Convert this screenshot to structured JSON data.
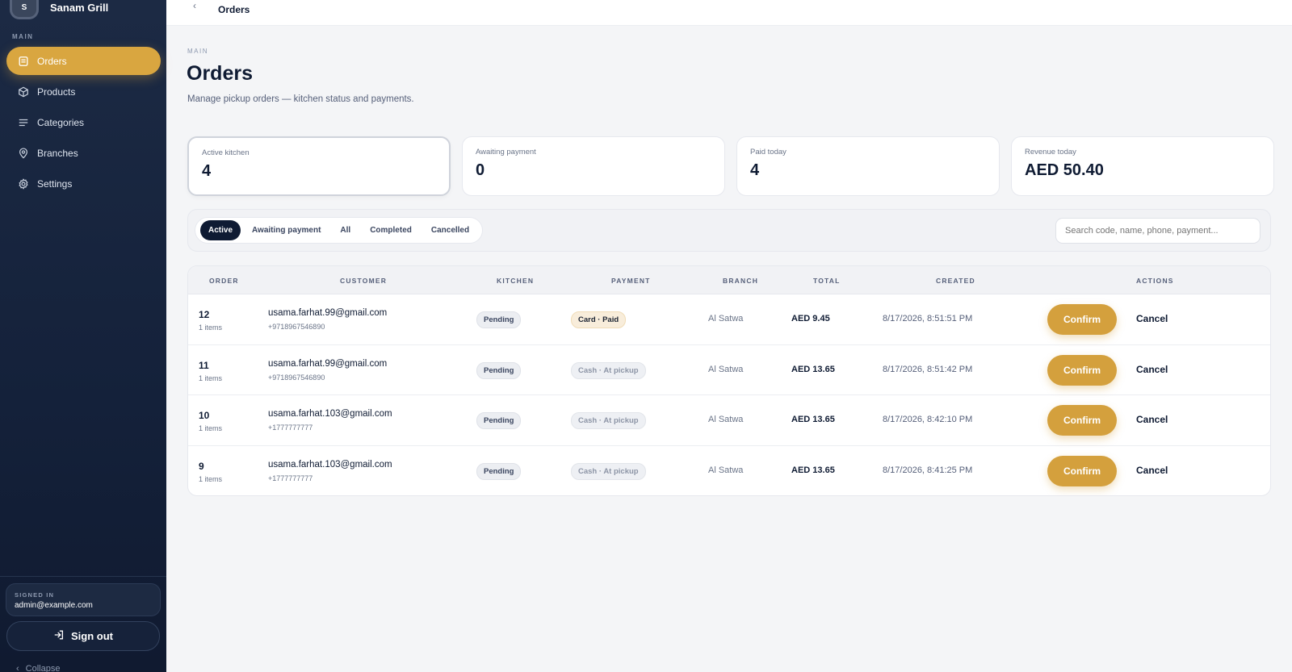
{
  "brand": {
    "initial": "S",
    "name": "Sanam Grill"
  },
  "sidebar": {
    "section_label": "MAIN",
    "items": [
      {
        "label": "Orders",
        "icon": "receipt-icon",
        "active": true
      },
      {
        "label": "Products",
        "icon": "box-icon",
        "active": false
      },
      {
        "label": "Categories",
        "icon": "list-icon",
        "active": false
      },
      {
        "label": "Branches",
        "icon": "map-pin-icon",
        "active": false
      },
      {
        "label": "Settings",
        "icon": "gear-icon",
        "active": false
      }
    ],
    "signed_in_label": "SIGNED IN",
    "signed_in_email": "admin@example.com",
    "sign_out_label": "Sign out",
    "collapse_label": "Collapse"
  },
  "topbar": {
    "back_icon": "chevron-left-icon",
    "title": "Orders"
  },
  "header": {
    "eyebrow": "MAIN",
    "title": "Orders",
    "subtitle": "Manage pickup orders — kitchen status and payments."
  },
  "stats": [
    {
      "label": "Active kitchen",
      "value": "4"
    },
    {
      "label": "Awaiting payment",
      "value": "0"
    },
    {
      "label": "Paid today",
      "value": "4"
    },
    {
      "label": "Revenue today",
      "value": "AED 50.40"
    }
  ],
  "filters": {
    "tabs": [
      "Active",
      "Awaiting payment",
      "All",
      "Completed",
      "Cancelled"
    ],
    "active_tab": "Active",
    "search_placeholder": "Search code, name, phone, payment..."
  },
  "table": {
    "columns": [
      "ORDER",
      "CUSTOMER",
      "KITCHEN",
      "PAYMENT",
      "BRANCH",
      "TOTAL",
      "CREATED",
      "ACTIONS"
    ],
    "rows": [
      {
        "order": "12",
        "items": "1 items",
        "email": "usama.farhat.99@gmail.com",
        "phone": "+9718967546890",
        "kitchen": "Pending",
        "payment": "Card · Paid",
        "paid": true,
        "branch": "Al Satwa",
        "total": "AED 9.45",
        "created": "8/17/2026, 8:51:51 PM",
        "confirm": "Confirm",
        "cancel": "Cancel"
      },
      {
        "order": "11",
        "items": "1 items",
        "email": "usama.farhat.99@gmail.com",
        "phone": "+9718967546890",
        "kitchen": "Pending",
        "payment": "Cash · At pickup",
        "paid": false,
        "branch": "Al Satwa",
        "total": "AED 13.65",
        "created": "8/17/2026, 8:51:42 PM",
        "confirm": "Confirm",
        "cancel": "Cancel"
      },
      {
        "order": "10",
        "items": "1 items",
        "email": "usama.farhat.103@gmail.com",
        "phone": "+1777777777",
        "kitchen": "Pending",
        "payment": "Cash · At pickup",
        "paid": false,
        "branch": "Al Satwa",
        "total": "AED 13.65",
        "created": "8/17/2026, 8:42:10 PM",
        "confirm": "Confirm",
        "cancel": "Cancel"
      },
      {
        "order": "9",
        "items": "1 items",
        "email": "usama.farhat.103@gmail.com",
        "phone": "+1777777777",
        "kitchen": "Pending",
        "payment": "Cash · At pickup",
        "paid": false,
        "branch": "Al Satwa",
        "total": "AED 13.65",
        "created": "8/17/2026, 8:41:25 PM",
        "confirm": "Confirm",
        "cancel": "Cancel"
      }
    ]
  },
  "colors": {
    "accent": "#d9a640",
    "sidebar": "#14213a",
    "dark": "#0f1b33"
  }
}
